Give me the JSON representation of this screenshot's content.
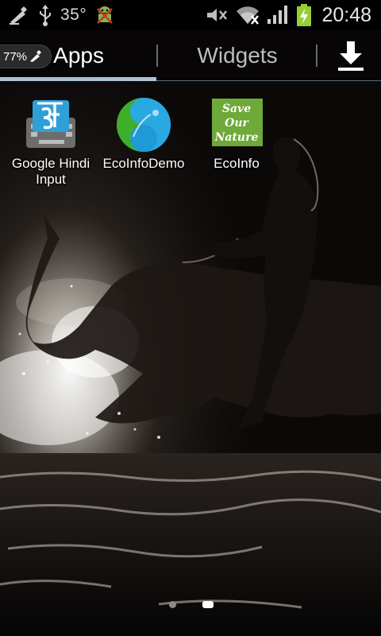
{
  "status_bar": {
    "temperature": "35°",
    "time": "20:48",
    "icons": [
      "cleaner-icon",
      "usb-icon",
      "android-debug-icon",
      "mute-icon",
      "wifi-icon",
      "signal-icon",
      "battery-charging-icon"
    ],
    "battery_color": "#9acd32"
  },
  "tabs": {
    "battery_percent": "77%",
    "apps_label": "Apps",
    "widgets_label": "Widgets",
    "selected": "Apps",
    "indicator_color": "#a9c3d8"
  },
  "apps": [
    {
      "label": "Google Hindi Input",
      "icon": "google-hindi-input-icon"
    },
    {
      "label": "EcoInfoDemo",
      "icon": "ecoinfo-demo-icon"
    },
    {
      "label": "EcoInfo",
      "icon": "save-our-nature-icon",
      "icon_text": [
        "Save",
        "Our",
        "Nature"
      ]
    }
  ],
  "pages": {
    "count": 2,
    "current": 2
  }
}
